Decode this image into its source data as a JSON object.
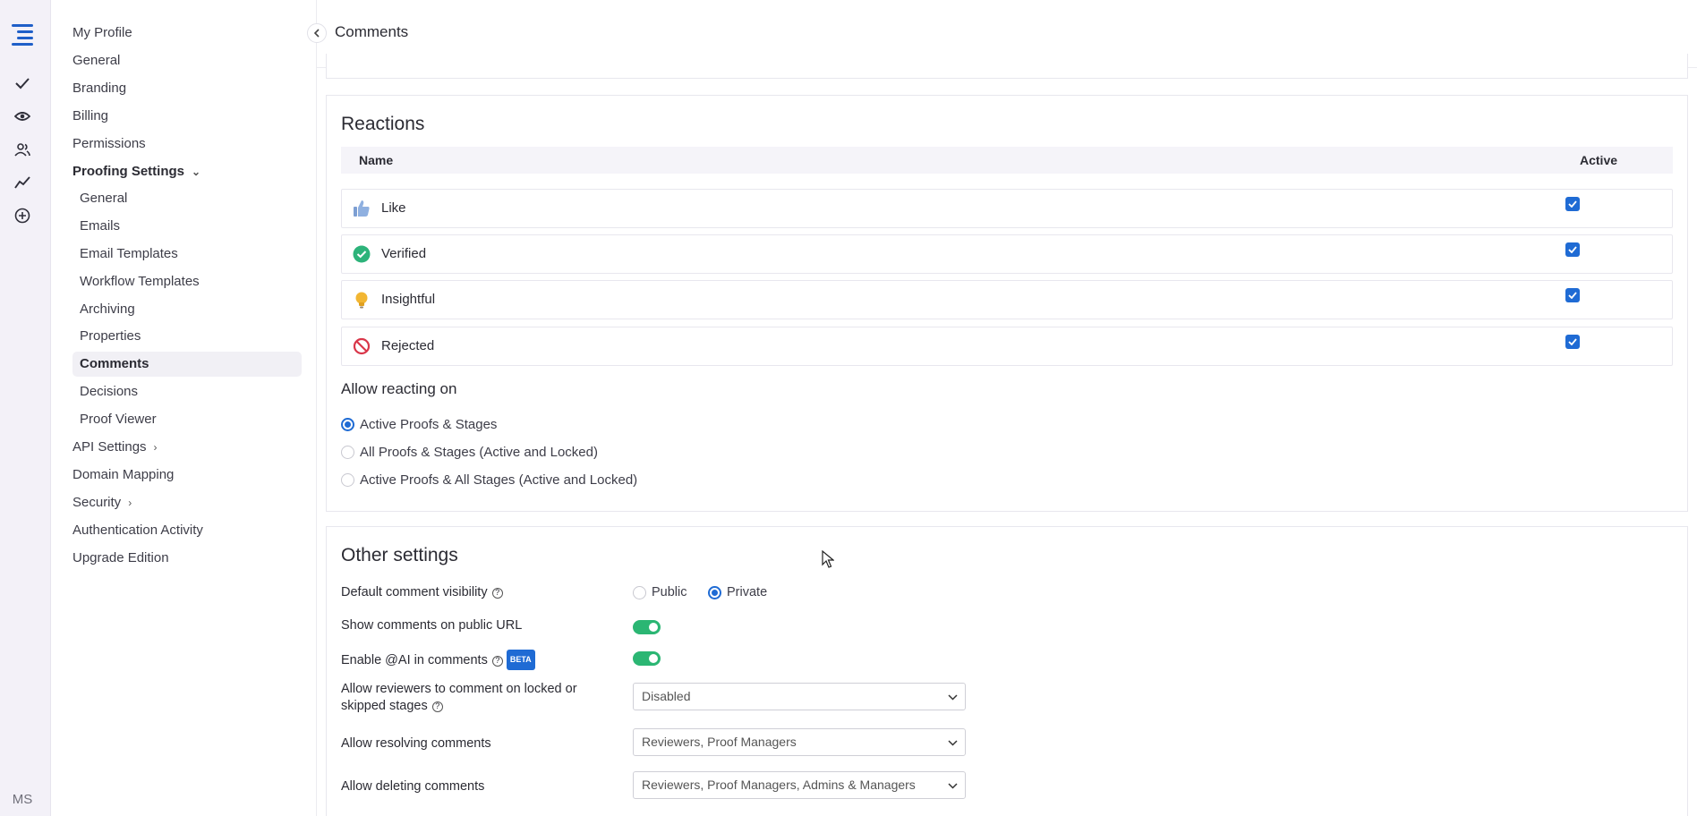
{
  "header": {
    "title": "Comments"
  },
  "rail": {
    "avatar": "MS"
  },
  "sidebar": {
    "items": [
      {
        "label": "My Profile"
      },
      {
        "label": "General"
      },
      {
        "label": "Branding"
      },
      {
        "label": "Billing"
      },
      {
        "label": "Permissions"
      },
      {
        "label": "Proofing Settings"
      },
      {
        "label": "General"
      },
      {
        "label": "Emails"
      },
      {
        "label": "Email Templates"
      },
      {
        "label": "Workflow Templates"
      },
      {
        "label": "Archiving"
      },
      {
        "label": "Properties"
      },
      {
        "label": "Comments"
      },
      {
        "label": "Decisions"
      },
      {
        "label": "Proof Viewer"
      },
      {
        "label": "API Settings"
      },
      {
        "label": "Domain Mapping"
      },
      {
        "label": "Security"
      },
      {
        "label": "Authentication Activity"
      },
      {
        "label": "Upgrade Edition"
      }
    ]
  },
  "reactions": {
    "title": "Reactions",
    "col_name": "Name",
    "col_active": "Active",
    "rows": [
      {
        "label": "Like",
        "icon": "thumbs-up-icon",
        "active": true
      },
      {
        "label": "Verified",
        "icon": "check-circle-icon",
        "active": true
      },
      {
        "label": "Insightful",
        "icon": "lightbulb-icon",
        "active": true
      },
      {
        "label": "Rejected",
        "icon": "no-entry-icon",
        "active": true
      }
    ],
    "allow_title": "Allow reacting on",
    "options": [
      {
        "label": "Active Proofs & Stages",
        "selected": true
      },
      {
        "label": "All Proofs & Stages (Active and Locked)",
        "selected": false
      },
      {
        "label": "Active Proofs & All Stages (Active and Locked)",
        "selected": false
      }
    ]
  },
  "other": {
    "title": "Other settings",
    "visibility_label": "Default comment visibility",
    "visibility_public": "Public",
    "visibility_private": "Private",
    "show_public_label": "Show comments on public URL",
    "ai_label": "Enable @AI in comments",
    "beta": "BETA",
    "locked_label_1": "Allow reviewers to comment on locked or",
    "locked_label_2": "skipped stages",
    "locked_value": "Disabled",
    "resolve_label": "Allow resolving comments",
    "resolve_value": "Reviewers, Proof Managers",
    "delete_label": "Allow deleting comments",
    "delete_value": "Reviewers, Proof Managers, Admins & Managers"
  },
  "colors": {
    "accent": "#1f6bd4",
    "toggle_on": "#2bb673"
  }
}
